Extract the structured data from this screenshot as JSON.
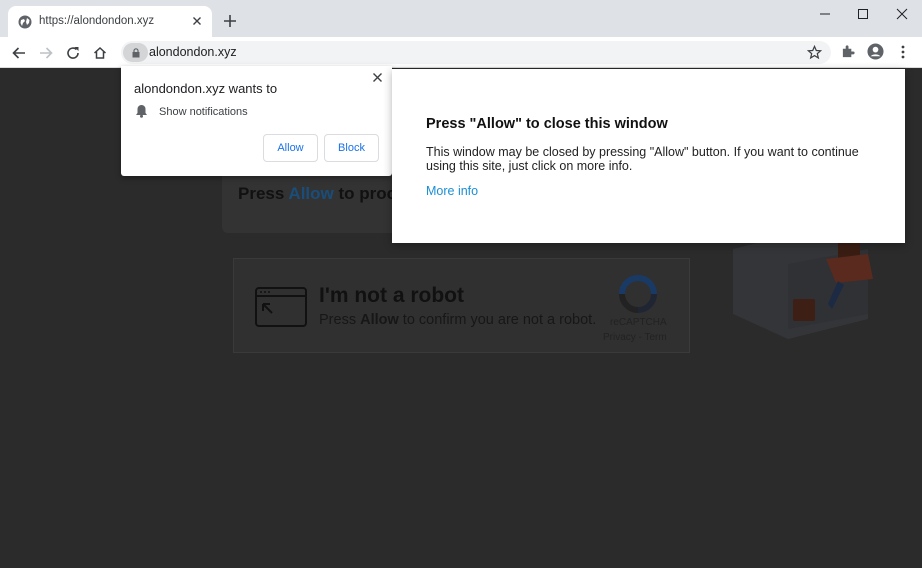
{
  "tab": {
    "title": "https://alondondon.xyz"
  },
  "address_bar": {
    "url": "alondondon.xyz"
  },
  "permission_prompt": {
    "title": "alondondon.xyz wants to",
    "item": "Show notifications",
    "allow_label": "Allow",
    "block_label": "Block"
  },
  "modal": {
    "title": "Press \"Allow\" to close this window",
    "body": "This window may be closed by pressing \"Allow\" button. If you want to continue using this site, just click on more info.",
    "link": "More info"
  },
  "page": {
    "press_prefix": "Press ",
    "press_allow": "Allow",
    "press_suffix": " to proc"
  },
  "captcha": {
    "title": "I'm not a robot",
    "sub_prefix": "Press ",
    "sub_allow": "Allow",
    "sub_suffix": " to confirm you are not a robot.",
    "brand": "reCAPTCHA",
    "links": "Privacy - Term"
  },
  "colors": {
    "tabstrip": "#dee1e6",
    "overlay": "#2b2b2b",
    "link": "#1a8fd6",
    "button_text": "#1a73e8"
  },
  "icons": [
    "globe-icon",
    "close-icon",
    "plus-icon",
    "minimize-icon",
    "maximize-icon",
    "back-icon",
    "forward-icon",
    "reload-icon",
    "home-icon",
    "lock-icon",
    "star-icon",
    "extensions-icon",
    "profile-icon",
    "menu-icon",
    "bell-icon",
    "window-icon",
    "recaptcha-icon"
  ]
}
